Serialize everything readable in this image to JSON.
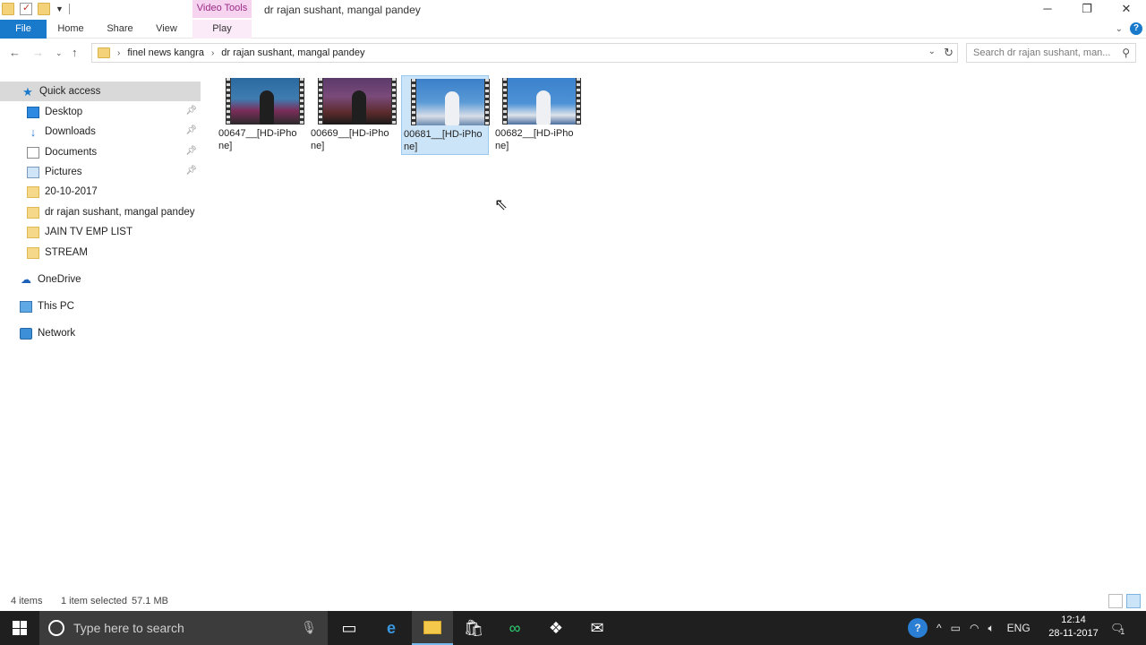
{
  "window": {
    "title": "dr rajan sushant, mangal pandey",
    "context_tab": "Video Tools",
    "controls": {
      "minimize": "─",
      "restore": "❐",
      "close": "✕"
    }
  },
  "ribbon": {
    "tabs": [
      {
        "label": "File"
      },
      {
        "label": "Home"
      },
      {
        "label": "Share"
      },
      {
        "label": "View"
      },
      {
        "label": "Play"
      }
    ],
    "expand_icon": "chevron-down-icon",
    "help_icon": "help-icon"
  },
  "address": {
    "crumbs": [
      "finel news kangra",
      "dr rajan sushant, mangal pandey"
    ],
    "search_placeholder": "Search dr rajan sushant, man..."
  },
  "nav": {
    "quick_access": "Quick access",
    "pinned": [
      {
        "label": "Desktop",
        "icon": "desktop-icon"
      },
      {
        "label": "Downloads",
        "icon": "downloads-icon"
      },
      {
        "label": "Documents",
        "icon": "documents-icon"
      },
      {
        "label": "Pictures",
        "icon": "pictures-icon"
      }
    ],
    "recent": [
      {
        "label": "20-10-2017"
      },
      {
        "label": "dr rajan sushant, mangal pandey"
      },
      {
        "label": "JAIN TV EMP LIST"
      },
      {
        "label": "STREAM"
      }
    ],
    "onedrive": "OneDrive",
    "this_pc": "This PC",
    "network": "Network"
  },
  "files": [
    {
      "name": "00647__[HD-iPhone]",
      "selected": false
    },
    {
      "name": "00669__[HD-iPhone]",
      "selected": false
    },
    {
      "name": "00681__[HD-iPhone]",
      "selected": true
    },
    {
      "name": "00682__[HD-iPhone]",
      "selected": false
    }
  ],
  "status": {
    "count": "4 items",
    "selection": "1 item selected",
    "size": "57.1 MB"
  },
  "taskbar": {
    "search_placeholder": "Type here to search",
    "icons": [
      "task-view-icon",
      "edge-icon",
      "file-explorer-icon",
      "store-icon",
      "infinity-icon",
      "dropbox-icon",
      "mail-icon"
    ],
    "language": "ENG",
    "time": "12:14",
    "date": "28-11-2017",
    "notification_count": "1"
  },
  "colors": {
    "accent": "#1979ca",
    "selection": "#cce4f7",
    "context_tab": "#f6d3ef"
  }
}
